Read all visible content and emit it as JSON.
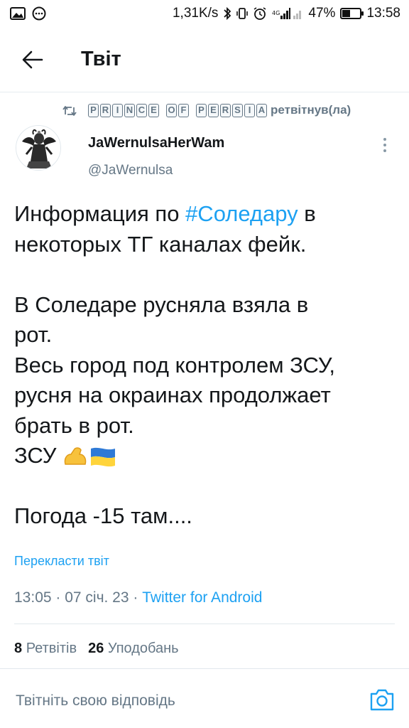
{
  "status_bar": {
    "speed": "1,31K/s",
    "network": "4G",
    "battery": "47%",
    "battery_level": 0.47,
    "time": "13:58",
    "icons": [
      "gallery-icon",
      "chat-icon",
      "bluetooth-icon",
      "vibrate-icon",
      "alarm-icon",
      "signal-icon",
      "battery-icon"
    ]
  },
  "header": {
    "title": "Твіт",
    "back_icon": "arrow-left-icon"
  },
  "retweet": {
    "icon": "retweet-icon",
    "retweeter_letters": [
      "P",
      "R",
      "I",
      "N",
      "C",
      "E",
      " ",
      "O",
      "F",
      " ",
      "P",
      "E",
      "R",
      "S",
      "I",
      "A"
    ],
    "retweeter_name": "PRINCE OF PERSIA",
    "suffix": "ретвітнув(ла)"
  },
  "tweet": {
    "author_name": "JaWernulsaHerWam",
    "author_handle": "@JaWernulsa",
    "text": {
      "line1_pre": "Информация по ",
      "hashtag": "#Соледару",
      "line1_post": " в",
      "line2": "некоторых ТГ каналах фейк.",
      "line3": "В Соледаре русняла взяла в",
      "line4": "рот.",
      "line5": "Весь город под контролем ЗСУ,",
      "line6": "русня на окраинах продолжает",
      "line7": "брать в рот.",
      "line8": "ЗСУ ",
      "line8_emoji": "💪🇺🇦",
      "line9": "Погода -15 там...."
    },
    "translate_label": "Перекласти твіт",
    "timestamp": "13:05 · 07 січ. 23 · ",
    "source": "Twitter for Android"
  },
  "stats": {
    "retweets_count": "8",
    "retweets_label": "Ретвітів",
    "likes_count": "26",
    "likes_label": "Уподобань"
  },
  "reply": {
    "placeholder": "Твітніть свою відповідь",
    "camera_icon": "camera-icon"
  },
  "colors": {
    "accent": "#1da1f2",
    "text": "#14171a",
    "secondary": "#657786",
    "divider": "#e1e8ed"
  }
}
